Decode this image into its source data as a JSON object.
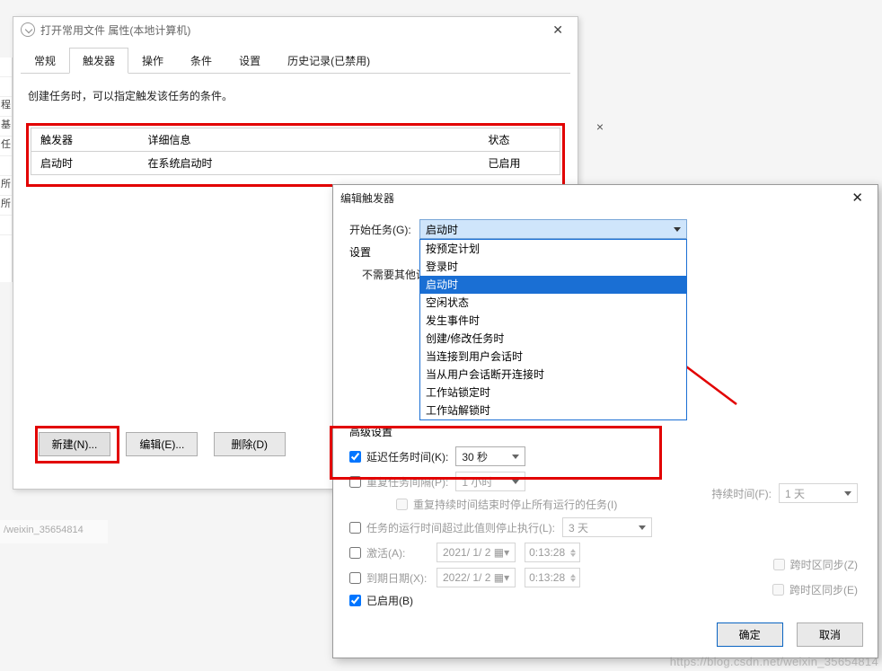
{
  "win1": {
    "title": "打开常用文件 属性(本地计算机)",
    "tabs": [
      "常规",
      "触发器",
      "操作",
      "条件",
      "设置",
      "历史记录(已禁用)"
    ],
    "active_tab_index": 1,
    "description": "创建任务时，可以指定触发该任务的条件。",
    "table": {
      "cols": [
        "触发器",
        "详细信息",
        "状态"
      ],
      "row": {
        "trigger": "启动时",
        "detail": "在系统启动时",
        "status": "已启用"
      }
    },
    "buttons": {
      "new": "新建(N)...",
      "edit": "编辑(E)...",
      "delete": "删除(D)"
    }
  },
  "left_sliver": [
    "",
    "",
    "程",
    "基",
    "任",
    "",
    "所",
    "所",
    ""
  ],
  "bottom_bar": "/weixin_35654814",
  "dim_close": "×",
  "win2": {
    "title": "编辑触发器",
    "begin_label": "开始任务(G):",
    "begin_selected": "启动时",
    "dropdown": [
      "按预定计划",
      "登录时",
      "启动时",
      "空闲状态",
      "发生事件时",
      "创建/修改任务时",
      "当连接到用户会话时",
      "当从用户会话断开连接时",
      "工作站锁定时",
      "工作站解锁时"
    ],
    "dropdown_hl_index": 2,
    "settings_label": "设置",
    "no_need_line": "不需要其他设",
    "adv_label": "高级设置",
    "delay": {
      "label": "延迟任务时间(K):",
      "value": "30 秒",
      "checked": true
    },
    "repeat": {
      "label": "重复任务间隔(P):",
      "value": "1 小时",
      "checked": false
    },
    "repeat_note": "重复持续时间结束时停止所有运行的任务(I)",
    "duration_label": "持续时间(F):",
    "duration_value": "1 天",
    "stop": {
      "label": "任务的运行时间超过此值则停止执行(L):",
      "value": "3 天",
      "checked": false
    },
    "activate": {
      "label": "激活(A):",
      "date": "2021/ 1/ 2",
      "time": "0:13:28",
      "checked": false,
      "tz": "跨时区同步(Z)"
    },
    "expire": {
      "label": "到期日期(X):",
      "date": "2022/ 1/ 2",
      "time": "0:13:28",
      "checked": false,
      "tz": "跨时区同步(E)"
    },
    "enabled": {
      "label": "已启用(B)",
      "checked": true
    },
    "ok": "确定",
    "cancel": "取消"
  },
  "watermark": "https://blog.csdn.net/weixin_35654814"
}
